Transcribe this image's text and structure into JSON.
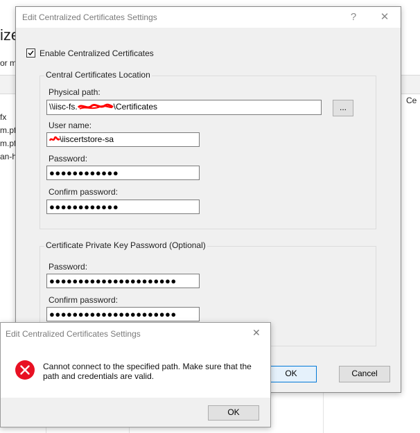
{
  "background": {
    "title_fragment": "ized",
    "subtitle_fragment": "or m",
    "list_fragments": [
      "fx",
      "m.pf",
      "m.pf",
      "an-h"
    ],
    "column_fragment": "Ce"
  },
  "dialog": {
    "title": "Edit Centralized Certificates Settings",
    "help_glyph": "?",
    "close_glyph": "✕",
    "enable_checkbox": {
      "label": "Enable Centralized Certificates",
      "checked": true
    },
    "location_group": {
      "title": "Central Certificates Location",
      "physical_path_label": "Physical path:",
      "physical_path_prefix": "\\\\iisc-fs.",
      "physical_path_suffix": "\\Certificates",
      "browse_label": "...",
      "username_label": "User name:",
      "username_suffix": "\\iiscertstore-sa",
      "password_label": "Password:",
      "password_value": "●●●●●●●●●●●●",
      "confirm_password_label": "Confirm password:",
      "confirm_password_value": "●●●●●●●●●●●●"
    },
    "private_key_group": {
      "title": "Certificate Private Key Password (Optional)",
      "password_label": "Password:",
      "password_value": "●●●●●●●●●●●●●●●●●●●●●●",
      "confirm_password_label": "Confirm password:",
      "confirm_password_value": "●●●●●●●●●●●●●●●●●●●●●●"
    },
    "ok_label": "OK",
    "cancel_label": "Cancel"
  },
  "error_dialog": {
    "title": "Edit Centralized Certificates Settings",
    "close_glyph": "✕",
    "message_line1": "Cannot connect to the specified path. Make sure that the",
    "message_line2": "path and credentials are valid.",
    "ok_label": "OK",
    "icon": "error-circle-x-icon",
    "icon_color": "#e81123"
  },
  "colors": {
    "redaction": "#ff0000",
    "focus_border": "#0078d7"
  }
}
